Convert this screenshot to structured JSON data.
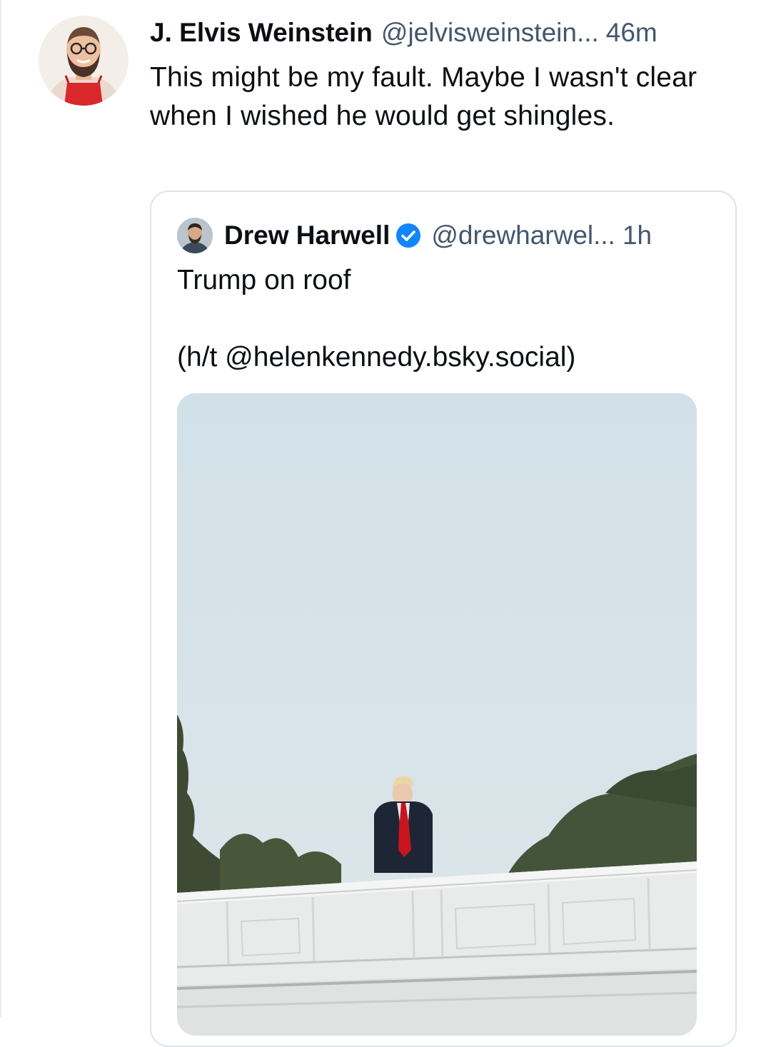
{
  "post": {
    "author_name": "J. Elvis Weinstein",
    "author_handle": "@jelvisweinstein...",
    "time": "46m",
    "text": "This might be my fault. Maybe I wasn't clear when I wished he would get shingles.",
    "avatar_icon": "user-avatar-bearded-man"
  },
  "quote": {
    "author_name": "Drew Harwell",
    "verified": true,
    "author_handle": "@drewharwel...",
    "time": "1h",
    "text_line1": "Trump on roof",
    "text_line2": "(h/t @helenkennedy.bsky.social)",
    "image_alt": "photo-man-standing-on-roof",
    "colors": {
      "verified_badge": "#1185fe",
      "secondary_text": "#42576c"
    }
  }
}
